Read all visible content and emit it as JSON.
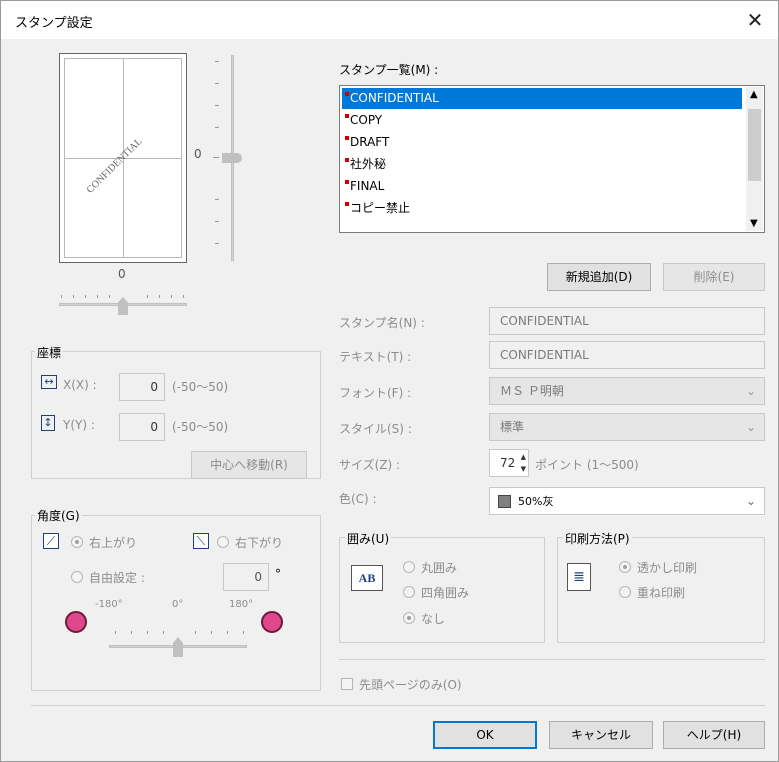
{
  "dialog": {
    "title": "スタンプ設定",
    "close": "✕"
  },
  "preview": {
    "stamp_text": "CONFIDENTIAL",
    "v_value": "0",
    "h_value": "0"
  },
  "list": {
    "label": "スタンプ一覧(M) :",
    "items": [
      "CONFIDENTIAL",
      "COPY",
      "DRAFT",
      "社外秘",
      "FINAL",
      "コピー禁止"
    ],
    "selected_index": 0
  },
  "buttons": {
    "add": "新規追加(D)",
    "delete": "削除(E)",
    "center": "中心へ移動(R)",
    "ok": "OK",
    "cancel": "キャンセル",
    "help": "ヘルプ(H)"
  },
  "fields": {
    "name_label": "スタンプ名(N) :",
    "name_value": "CONFIDENTIAL",
    "text_label": "テキスト(T) :",
    "text_value": "CONFIDENTIAL",
    "font_label": "フォント(F) :",
    "font_value": "ＭＳ Ｐ明朝",
    "style_label": "スタイル(S) :",
    "style_value": "標準",
    "size_label": "サイズ(Z) :",
    "size_value": "72",
    "size_range": "ポイント (1～500)",
    "color_label": "色(C) :",
    "color_value": "50%灰",
    "color_swatch": "#808080"
  },
  "coords": {
    "label": "座標",
    "x_label": "X(X) :",
    "x_value": "0",
    "x_range": "(-50～50)",
    "y_label": "Y(Y) :",
    "y_value": "0",
    "y_range": "(-50～50)"
  },
  "angle": {
    "label": "角度(G)",
    "up_right": "右上がり",
    "down_right": "右下がり",
    "free": "自由設定 :",
    "free_value": "0",
    "degree": "°",
    "min": "-180°",
    "mid": "0°",
    "max": "180°"
  },
  "border": {
    "label": "囲み(U)",
    "icon_text": "AB",
    "round": "丸囲み",
    "square": "四角囲み",
    "none": "なし"
  },
  "print_method": {
    "label": "印刷方法(P)",
    "transparent": "透かし印刷",
    "overlay": "重ね印刷"
  },
  "first_page": {
    "label": "先頭ページのみ(O)"
  }
}
